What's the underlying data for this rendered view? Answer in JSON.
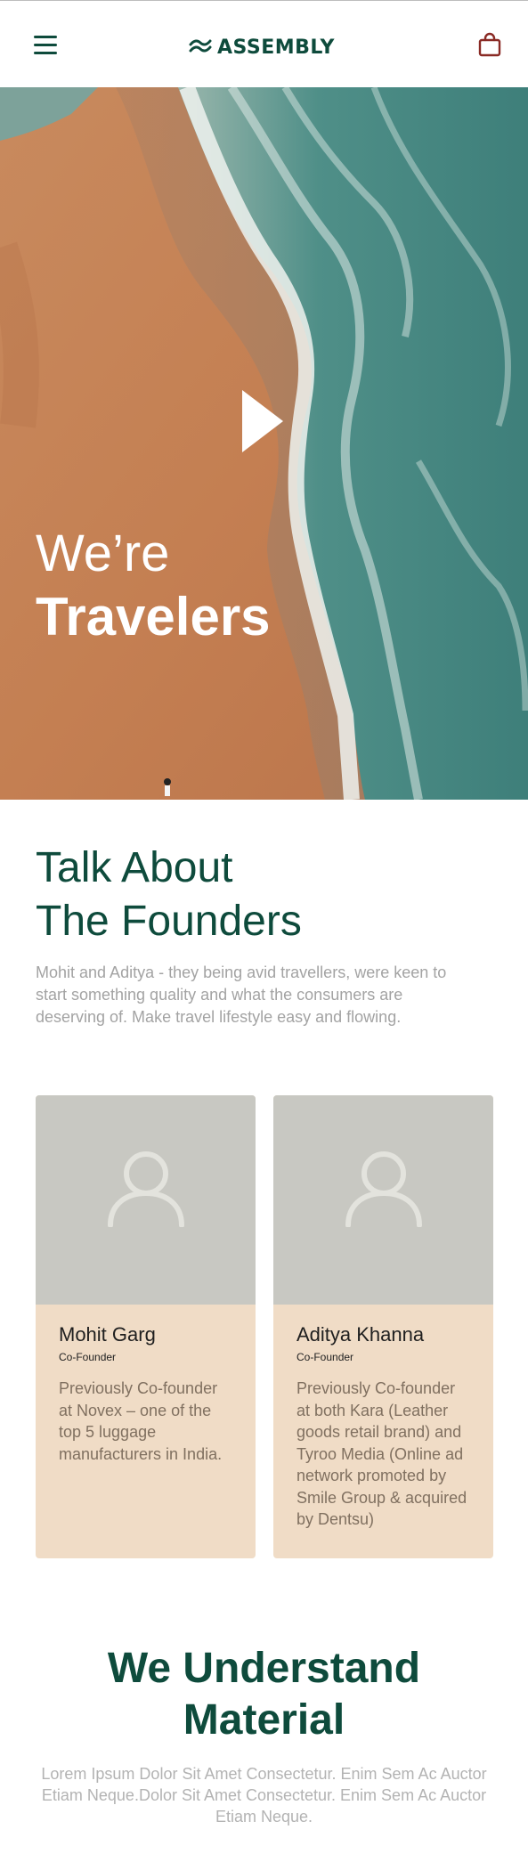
{
  "brand": {
    "name": "ASSEMBLY",
    "color": "#0e4b3c"
  },
  "nav": {
    "menu_icon": "hamburger-menu-icon",
    "cart_icon": "shopping-bag-icon"
  },
  "hero": {
    "line1": "We’re",
    "line2": "Travelers",
    "play_icon": "play-icon"
  },
  "founders": {
    "title_line1": "Talk About",
    "title_line2": "The Founders",
    "description": "Mohit and Aditya - they being avid travellers, were keen to start something quality and what the consumers are deserving of. Make travel lifestyle easy and flowing.",
    "cards": [
      {
        "name": "Mohit Garg",
        "role": "Co-Founder",
        "bio": "Previously Co-founder at Novex – one of the top 5 luggage manufacturers in India."
      },
      {
        "name": "Aditya Khanna",
        "role": "Co-Founder",
        "bio": "Previously Co-founder at both Kara (Leather goods retail brand) and Tyroo Media (Online ad network promoted by Smile Group & acquired by Dentsu)"
      }
    ]
  },
  "material": {
    "title_line1": "We Understand",
    "title_line2": "Material",
    "description": "Lorem Ipsum Dolor Sit Amet Consectetur. Enim Sem Ac Auctor Etiam Neque.Dolor Sit Amet Consectetur. Enim Sem Ac Auctor Etiam Neque."
  },
  "colors": {
    "accent": "#0e4b3c",
    "cart": "#8a2a25",
    "card_bg": "#f0dcc6",
    "photo_placeholder": "#c8c8c2"
  }
}
